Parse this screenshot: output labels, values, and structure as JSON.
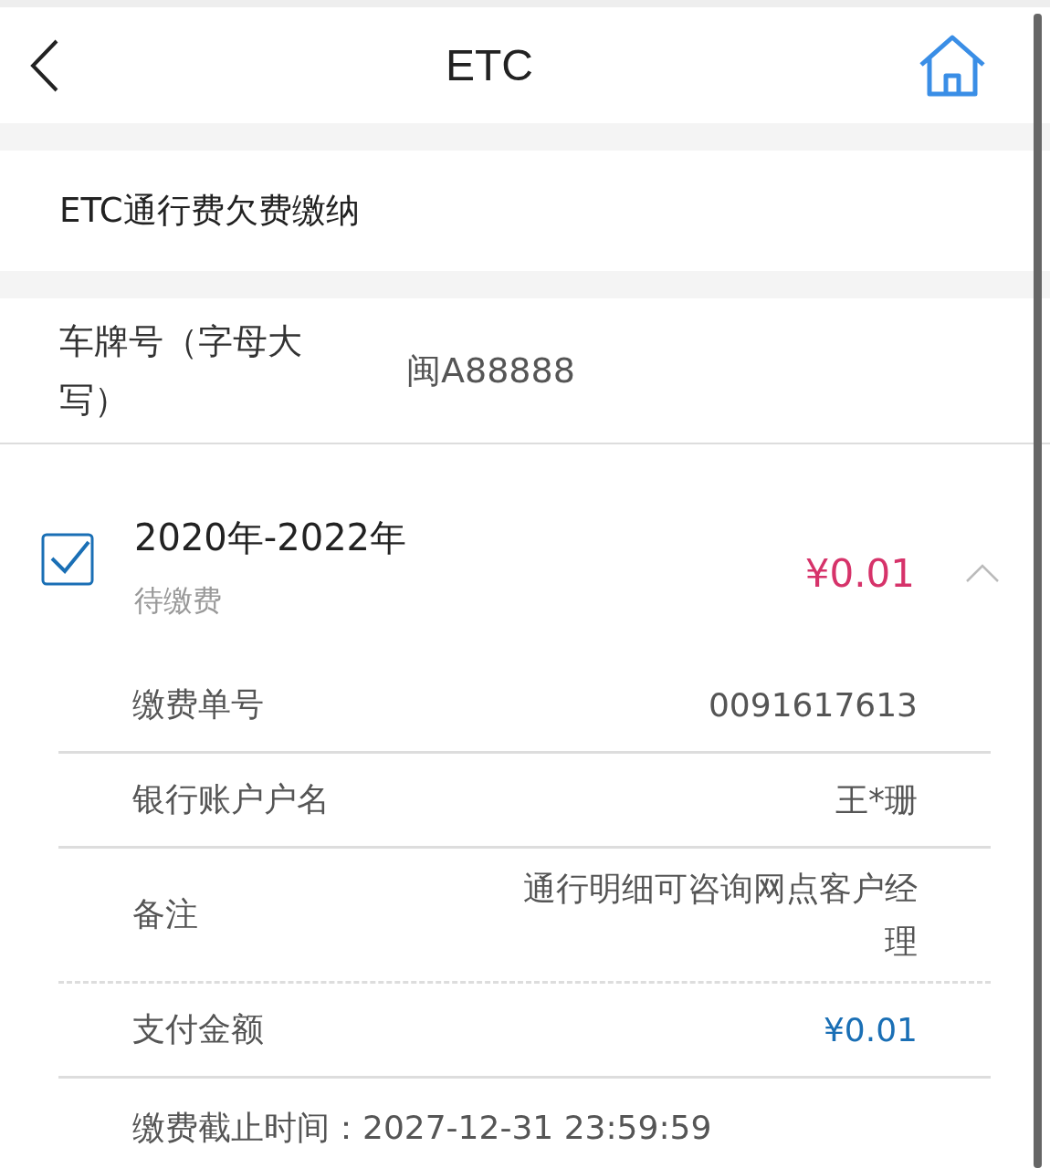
{
  "header": {
    "title": "ETC"
  },
  "section_title": "ETC通行费欠费缴纳",
  "plate": {
    "label": "车牌号（字母大写）",
    "value": "闽A88888"
  },
  "bills": [
    {
      "checked": true,
      "expanded": true,
      "period": "2020年-2022年",
      "status": "待缴费",
      "amount": "¥0.01",
      "details": [
        {
          "kind": "plain",
          "label": "缴费单号",
          "value": "0091617613"
        },
        {
          "kind": "plain",
          "label": "银行账户户名",
          "value": "王*珊"
        },
        {
          "kind": "remark",
          "label": "备注",
          "value": "通行明细可咨询网点客户经理"
        },
        {
          "kind": "amount",
          "label": "支付金额",
          "value": "¥0.01"
        }
      ],
      "deadline": "缴费截止时间：2027-12-31 23:59:59"
    }
  ]
}
